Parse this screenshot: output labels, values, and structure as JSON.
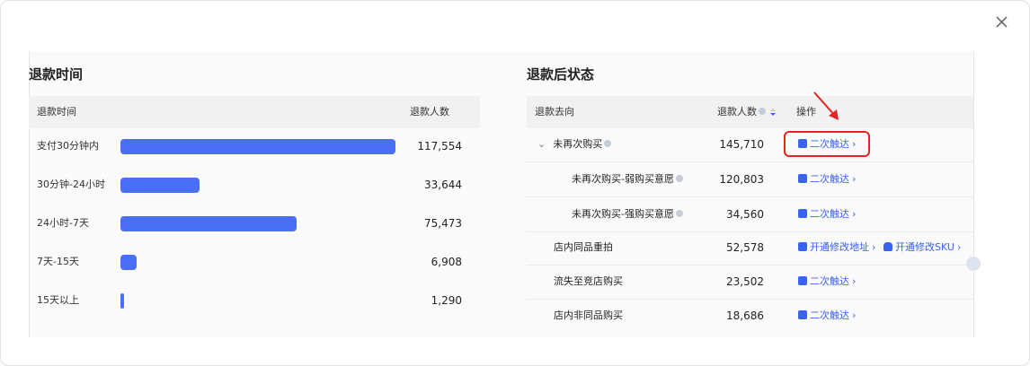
{
  "left_panel": {
    "title": "退款时间",
    "col_time": "退款时间",
    "col_count": "退款人数",
    "rows": [
      {
        "label": "支付30分钟内",
        "value": "117,554",
        "fraction": 1.0
      },
      {
        "label": "30分钟-24小时",
        "value": "33,644",
        "fraction": 0.286
      },
      {
        "label": "24小时-7天",
        "value": "75,473",
        "fraction": 0.642
      },
      {
        "label": "7天-15天",
        "value": "6,908",
        "fraction": 0.059
      },
      {
        "label": "15天以上",
        "value": "1,290",
        "fraction": 0.011
      }
    ],
    "bar_color": "#4a6ef4"
  },
  "right_panel": {
    "title": "退款后状态",
    "col_dest": "退款去向",
    "col_count": "退款人数",
    "col_action": "操作",
    "rows": [
      {
        "name": "未再次购买",
        "value": "145,710",
        "action": "二次触达",
        "expandable": true,
        "info": true
      },
      {
        "name": "未再次购买-弱购买意愿",
        "value": "120,803",
        "action": "二次触达",
        "info": true
      },
      {
        "name": "未再次购买-强购买意愿",
        "value": "34,560",
        "action": "二次触达",
        "info": true
      },
      {
        "name": "店内同品重拍",
        "value": "52,578",
        "action": "开通修改地址",
        "action2": "开通修改SKU"
      },
      {
        "name": "流失至竞店购买",
        "value": "23,502",
        "action": "二次触达"
      },
      {
        "name": "店内非同品购买",
        "value": "18,686",
        "action": "二次触达"
      }
    ],
    "link_color": "#3a62f0"
  },
  "highlight_color": "#e22424"
}
